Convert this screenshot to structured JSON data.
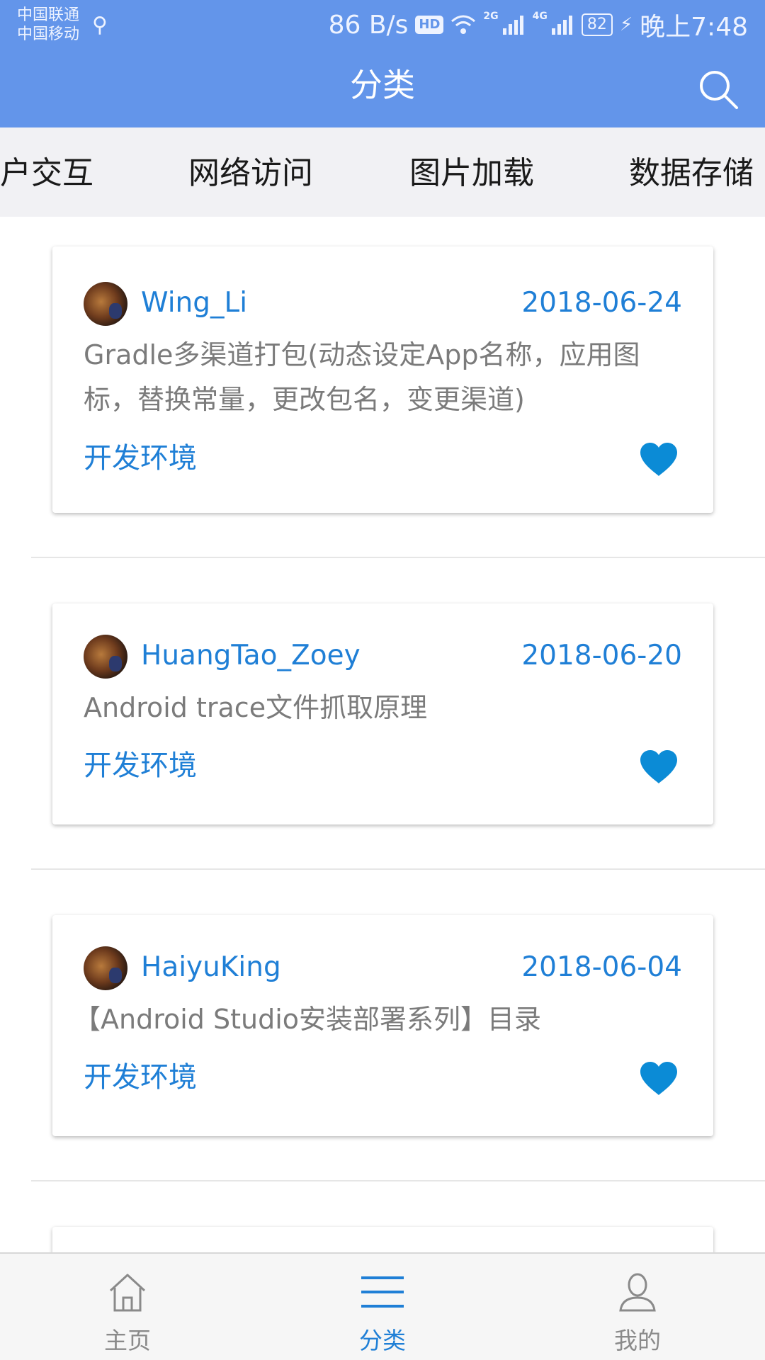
{
  "status_bar": {
    "carrier_1": "中国联通",
    "carrier_2": "中国移动",
    "net_speed": "86 B/s",
    "hd_badge": "HD",
    "sim1_network": "2G",
    "sim2_network": "4G",
    "battery": "82",
    "time": "晚上7:48"
  },
  "toolbar": {
    "title": "分类",
    "search_icon": "search-icon"
  },
  "tabs": [
    "户交互",
    "网络访问",
    "图片加载",
    "数据存储"
  ],
  "articles": [
    {
      "author": "Wing_Li",
      "date": "2018-06-24",
      "title": "Gradle多渠道打包(动态设定App名称，应用图标，替换常量，更改包名，变更渠道)",
      "tag": "开发环境"
    },
    {
      "author": "HuangTao_Zoey",
      "date": "2018-06-20",
      "title": "Android trace文件抓取原理",
      "tag": "开发环境"
    },
    {
      "author": "HaiyuKing",
      "date": "2018-06-04",
      "title": "【Android Studio安装部署系列】目录",
      "tag": "开发环境"
    }
  ],
  "bottom_nav": {
    "items": [
      {
        "label": "主页",
        "icon": "home-icon"
      },
      {
        "label": "分类",
        "icon": "menu-icon"
      },
      {
        "label": "我的",
        "icon": "user-icon"
      }
    ],
    "active_index": 1
  },
  "colors": {
    "toolbar_bg": "#6395ea",
    "accent": "#1f7fd6",
    "heart": "#0b8bd6"
  }
}
